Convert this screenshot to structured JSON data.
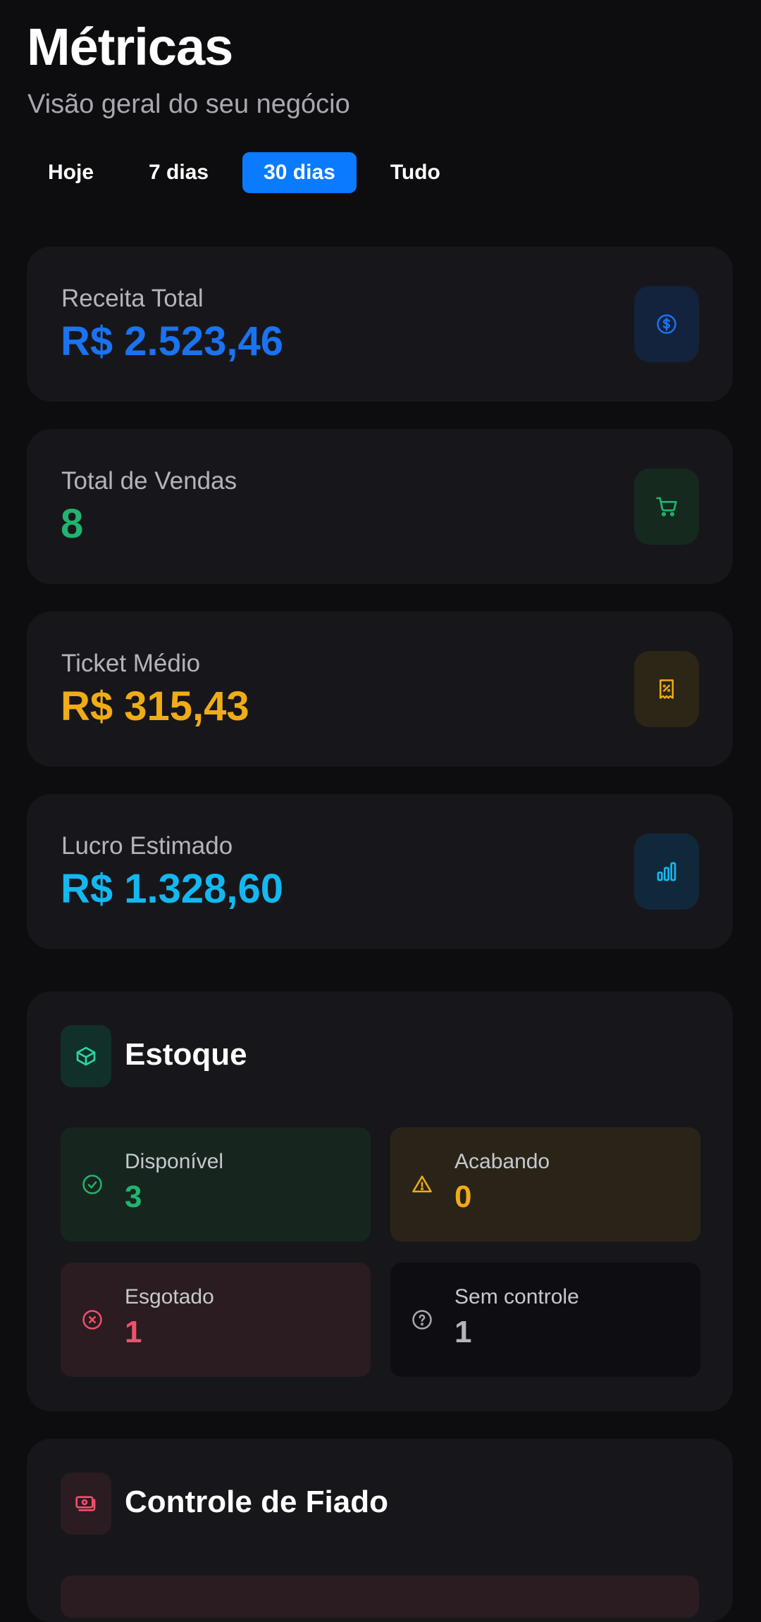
{
  "header": {
    "title": "Métricas",
    "subtitle": "Visão geral do seu negócio"
  },
  "tabs": [
    {
      "label": "Hoje",
      "active": false
    },
    {
      "label": "7 dias",
      "active": false
    },
    {
      "label": "30 dias",
      "active": true
    },
    {
      "label": "Tudo",
      "active": false
    }
  ],
  "cards": [
    {
      "label": "Receita Total",
      "value": "R$ 2.523,46",
      "color": "#1a73f0",
      "icon": "dollar-circle-icon"
    },
    {
      "label": "Total de Vendas",
      "value": "8",
      "color": "#21b46e",
      "icon": "shopping-cart-icon"
    },
    {
      "label": "Ticket Médio",
      "value": "R$ 315,43",
      "color": "#f0ac16",
      "icon": "receipt-percent-icon"
    },
    {
      "label": "Lucro Estimado",
      "value": "R$ 1.328,60",
      "color": "#14b8f0",
      "icon": "bar-chart-icon"
    }
  ],
  "estoque": {
    "title": "Estoque",
    "icon": "box-icon",
    "stats": [
      {
        "label": "Disponível",
        "value": "3",
        "color": "#21b46e",
        "icon": "check-circle-icon"
      },
      {
        "label": "Acabando",
        "value": "0",
        "color": "#f0ac16",
        "icon": "warning-triangle-icon"
      },
      {
        "label": "Esgotado",
        "value": "1",
        "color": "#f0506e",
        "icon": "x-circle-icon"
      },
      {
        "label": "Sem controle",
        "value": "1",
        "color": "#b4b4bc",
        "icon": "question-circle-icon"
      }
    ]
  },
  "fiado": {
    "title": "Controle de Fiado",
    "icon": "cash-icon"
  }
}
